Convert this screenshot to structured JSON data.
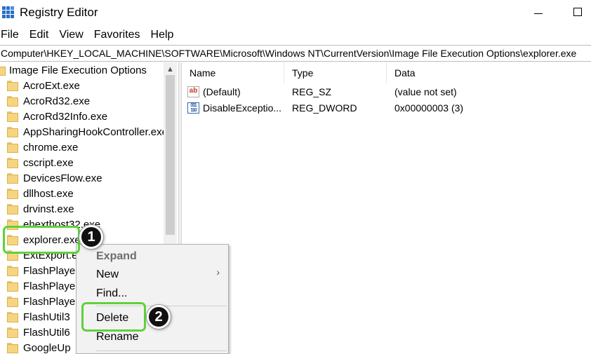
{
  "window": {
    "title": "Registry Editor",
    "icon": "registry-icon"
  },
  "menu": [
    "File",
    "Edit",
    "View",
    "Favorites",
    "Help"
  ],
  "address": "Computer\\HKEY_LOCAL_MACHINE\\SOFTWARE\\Microsoft\\Windows NT\\CurrentVersion\\Image File Execution Options\\explorer.exe",
  "tree": {
    "parent": "Image File Execution Options",
    "items": [
      "AcroExt.exe",
      "AcroRd32.exe",
      "AcroRd32Info.exe",
      "AppSharingHookController.exe",
      "chrome.exe",
      "cscript.exe",
      "DevicesFlow.exe",
      "dllhost.exe",
      "drvinst.exe",
      "ehexthost32.exe",
      "explorer.exe",
      "ExtExport.exe",
      "FlashPlaye",
      "FlashPlaye",
      "FlashPlaye",
      "FlashUtil3",
      "FlashUtil6",
      "GoogleUp"
    ],
    "selected": "explorer.exe"
  },
  "list": {
    "columns": [
      "Name",
      "Type",
      "Data"
    ],
    "rows": [
      {
        "icon": "string-value-icon",
        "name": "(Default)",
        "type": "REG_SZ",
        "data": "(value not set)"
      },
      {
        "icon": "dword-value-icon",
        "name": "DisableExceptio...",
        "type": "REG_DWORD",
        "data": "0x00000003 (3)"
      }
    ]
  },
  "context_menu": {
    "items": [
      "Expand",
      "New",
      "Find...",
      "Delete",
      "Rename"
    ],
    "bold_item": "Expand",
    "submenu_arrow": "›"
  },
  "annotations": {
    "badge_1": "1",
    "badge_2": "2",
    "highlight_color": "#5fd13a"
  },
  "colors": {
    "folder": "#f6d580",
    "menu_bg": "#f2f2f2"
  }
}
